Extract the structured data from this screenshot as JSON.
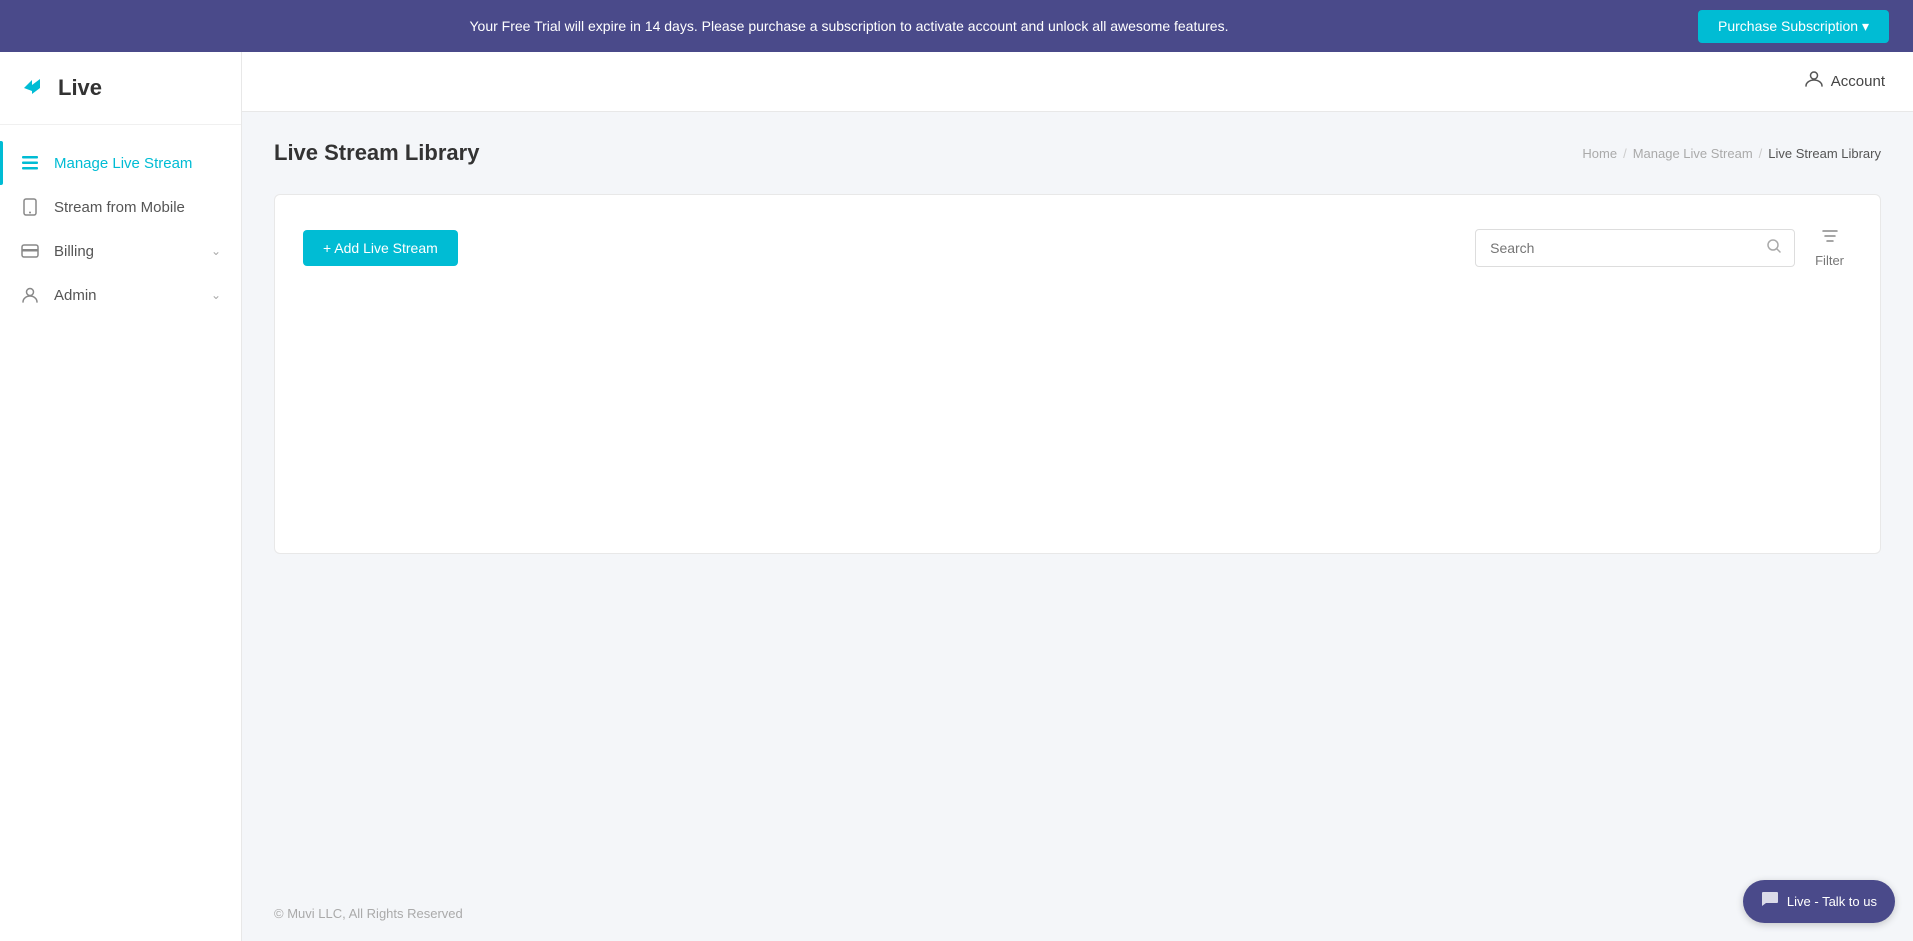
{
  "banner": {
    "text": "Your Free Trial will expire in 14 days. Please purchase a subscription to activate account and unlock all awesome features.",
    "button_label": "Purchase Subscription ▾"
  },
  "logo": {
    "text": "Live"
  },
  "nav": {
    "items": [
      {
        "id": "manage-live-stream",
        "label": "Manage Live Stream",
        "icon": "list-icon",
        "active": true,
        "hasChevron": false
      },
      {
        "id": "stream-from-mobile",
        "label": "Stream from Mobile",
        "icon": "mobile-icon",
        "active": false,
        "hasChevron": false
      },
      {
        "id": "billing",
        "label": "Billing",
        "icon": "billing-icon",
        "active": false,
        "hasChevron": true
      },
      {
        "id": "admin",
        "label": "Admin",
        "icon": "admin-icon",
        "active": false,
        "hasChevron": true
      }
    ]
  },
  "header": {
    "account_label": "Account"
  },
  "page": {
    "title": "Live Stream Library",
    "breadcrumb": [
      {
        "label": "Home",
        "active": false
      },
      {
        "label": "Manage Live Stream",
        "active": false
      },
      {
        "label": "Live Stream Library",
        "active": true
      }
    ],
    "add_button_label": "+ Add Live Stream",
    "search_placeholder": "Search",
    "filter_label": "Filter"
  },
  "footer": {
    "text": "© Muvi LLC, All Rights Reserved"
  },
  "live_chat": {
    "label": "Live - Talk to us"
  }
}
